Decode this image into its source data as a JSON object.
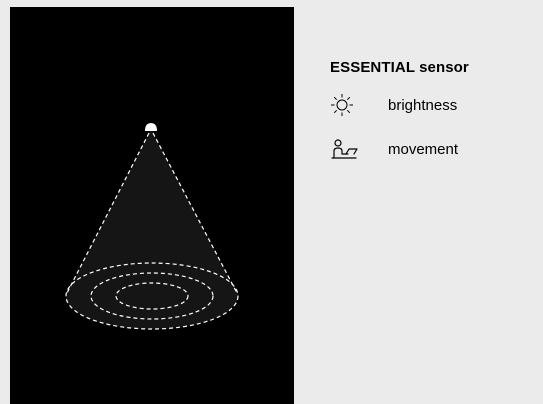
{
  "colors": {
    "page_background": "#ebebeb",
    "scene_background": "#000000",
    "cone_fill": "#1a1a1a",
    "dashed_lines": "#ffffff",
    "text": "#000000"
  },
  "scene": {
    "sensor_icon": "ceiling-sensor-icon",
    "detection_zone": "dashed-cone-with-concentric-rings"
  },
  "info": {
    "title": "ESSENTIAL sensor",
    "features": [
      {
        "icon": "sun-icon",
        "label": "brightness"
      },
      {
        "icon": "person-at-desk-icon",
        "label": "movement"
      }
    ]
  }
}
